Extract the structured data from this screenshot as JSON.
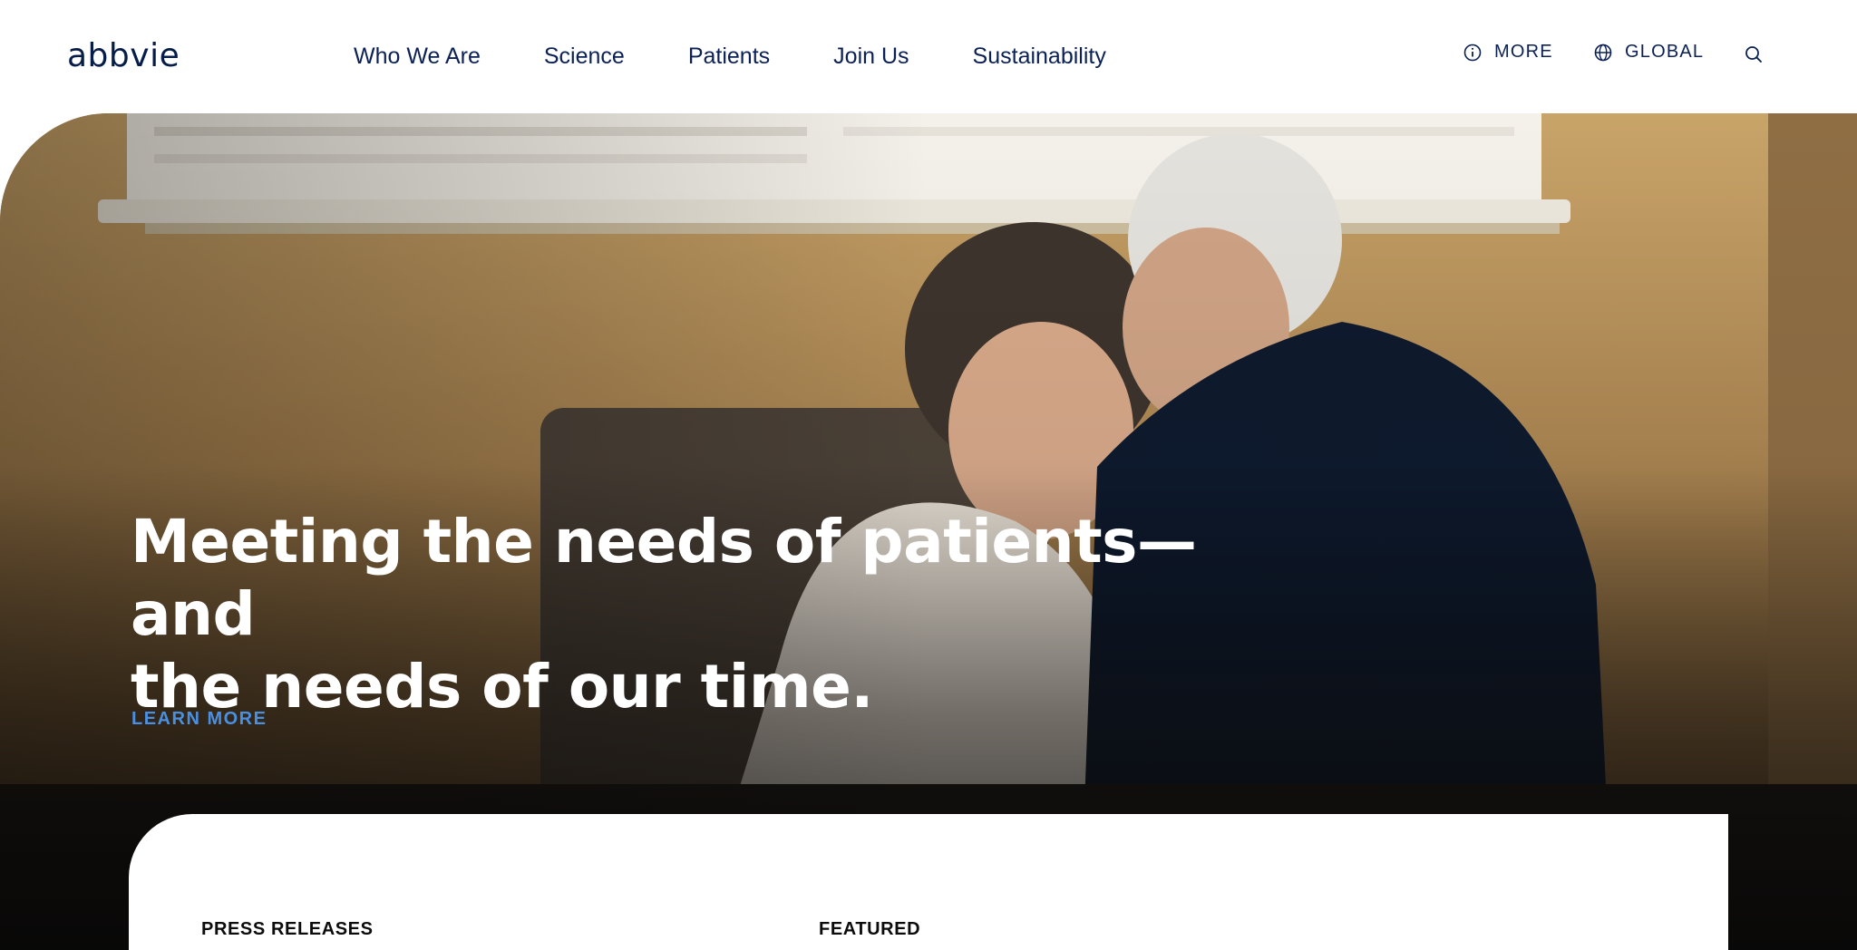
{
  "brand": {
    "logo_text": "abbvie",
    "colors": {
      "navy": "#071d49",
      "accent_link": "#4a90e2",
      "white": "#ffffff"
    }
  },
  "nav": {
    "items": [
      {
        "label": "Who We Are"
      },
      {
        "label": "Science"
      },
      {
        "label": "Patients"
      },
      {
        "label": "Join Us"
      },
      {
        "label": "Sustainability"
      }
    ]
  },
  "utility": {
    "more": {
      "label": "MORE",
      "icon": "info-circle-icon"
    },
    "global": {
      "label": "GLOBAL",
      "icon": "globe-icon"
    },
    "search": {
      "icon": "search-icon"
    }
  },
  "hero": {
    "title_line1": "Meeting the needs of patients—and",
    "title_line2": "the needs of our time.",
    "cta": "LEARN MORE"
  },
  "sections": {
    "press_releases": "PRESS RELEASES",
    "featured": "FEATURED"
  }
}
